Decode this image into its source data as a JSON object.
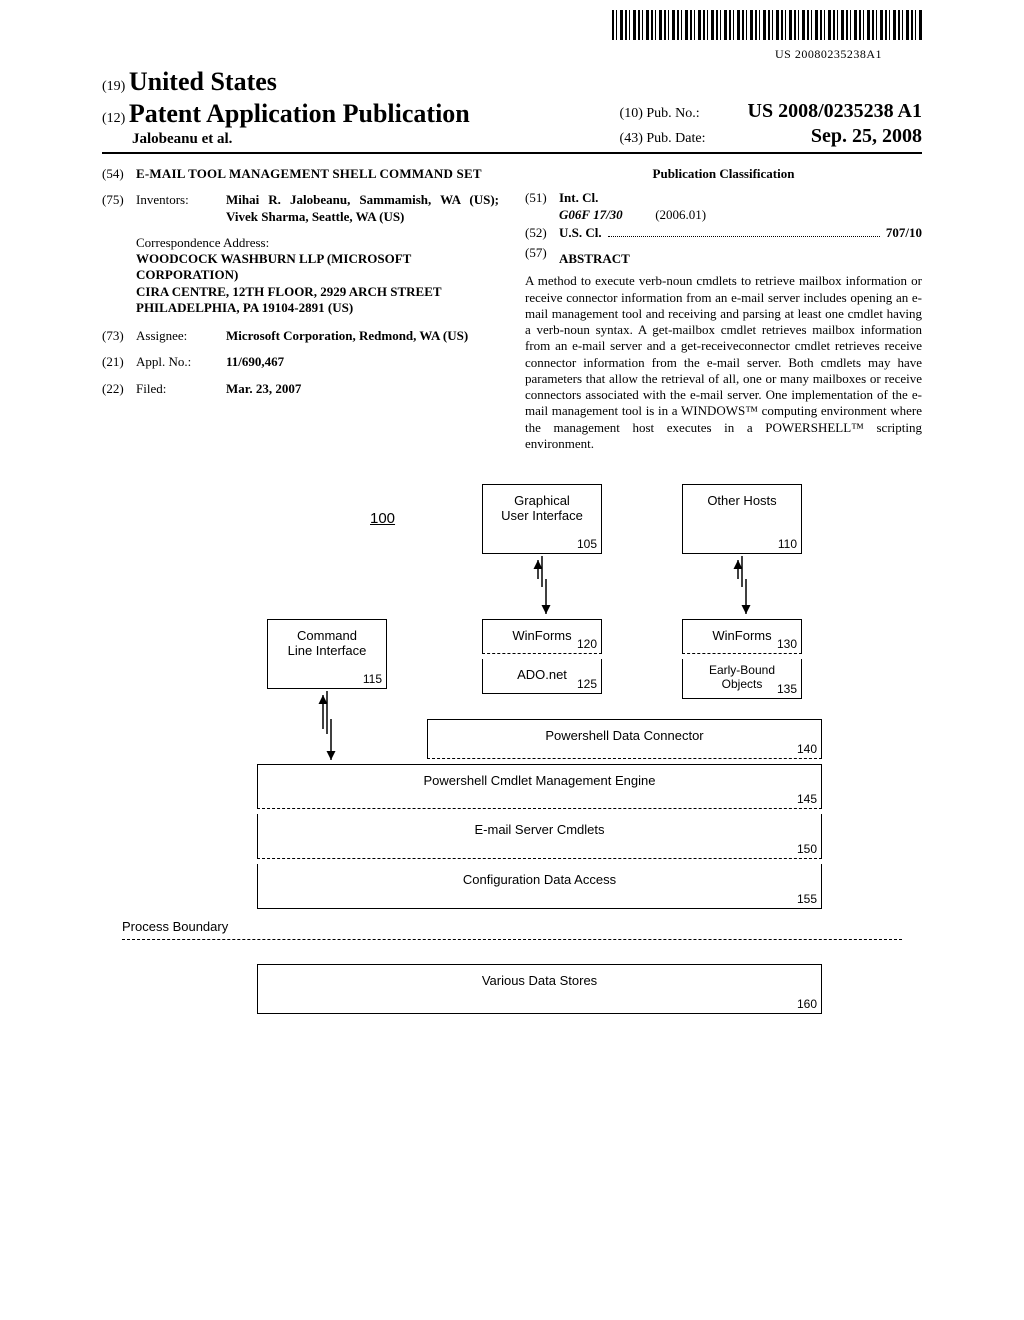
{
  "barcode_num": "US 20080235238A1",
  "header": {
    "country_label": "(19)",
    "country": "United States",
    "pub_label": "(12)",
    "pub_title": "Patent Application Publication",
    "authors": "Jalobeanu et al.",
    "pubno_label": "(10) Pub. No.:",
    "pubno": "US 2008/0235238 A1",
    "pubdate_label": "(43) Pub. Date:",
    "pubdate": "Sep. 25, 2008"
  },
  "left": {
    "n54": "(54)",
    "title": "E-MAIL TOOL MANAGEMENT SHELL COMMAND SET",
    "n75": "(75)",
    "inv_label": "Inventors:",
    "inventors": "Mihai R. Jalobeanu, Sammamish, WA (US); Vivek Sharma, Seattle, WA (US)",
    "corr_label": "Correspondence Address:",
    "corr_addr": "WOODCOCK WASHBURN LLP (MICROSOFT CORPORATION)\nCIRA CENTRE, 12TH FLOOR, 2929 ARCH STREET\nPHILADELPHIA, PA 19104-2891 (US)",
    "n73": "(73)",
    "assignee_label": "Assignee:",
    "assignee": "Microsoft Corporation, Redmond, WA (US)",
    "n21": "(21)",
    "appl_label": "Appl. No.:",
    "appl_no": "11/690,467",
    "n22": "(22)",
    "filed_label": "Filed:",
    "filed": "Mar. 23, 2007"
  },
  "right": {
    "pubclass": "Publication Classification",
    "n51": "(51)",
    "intcl_label": "Int. Cl.",
    "intcl_code": "G06F 17/30",
    "intcl_year": "(2006.01)",
    "n52": "(52)",
    "uscl_label": "U.S. Cl.",
    "uscl_val": "707/10",
    "n57": "(57)",
    "abstract_label": "ABSTRACT",
    "abstract": "A method to execute verb-noun cmdlets to retrieve mailbox information or receive connector information from an e-mail server includes opening an e-mail management tool and receiving and parsing at least one cmdlet having a verb-noun syntax. A get-mailbox cmdlet retrieves mailbox information from an e-mail server and a get-receiveconnector cmdlet retrieves receive connector information from the e-mail server. Both cmdlets may have parameters that allow the retrieval of all, one or many mailboxes or receive connectors associated with the e-mail server. One implementation of the e-mail management tool is in a WINDOWS™ computing environment where the management host executes in a POWERSHELL™ scripting environment."
  },
  "diagram": {
    "ref100": "100",
    "gui": "Graphical\nUser Interface",
    "gui_ref": "105",
    "other": "Other Hosts",
    "other_ref": "110",
    "cli": "Command\nLine Interface",
    "cli_ref": "115",
    "wf1": "WinForms",
    "wf1_ref": "120",
    "wf2": "WinForms",
    "wf2_ref": "130",
    "ado": "ADO.net",
    "ado_ref": "125",
    "ebo": "Early-Bound\nObjects",
    "ebo_ref": "135",
    "pdc": "Powershell Data Connector",
    "pdc_ref": "140",
    "pcm": "Powershell Cmdlet Management Engine",
    "pcm_ref": "145",
    "esc": "E-mail Server Cmdlets",
    "esc_ref": "150",
    "cda": "Configuration Data Access",
    "cda_ref": "155",
    "vds": "Various Data Stores",
    "vds_ref": "160",
    "proc": "Process Boundary"
  }
}
